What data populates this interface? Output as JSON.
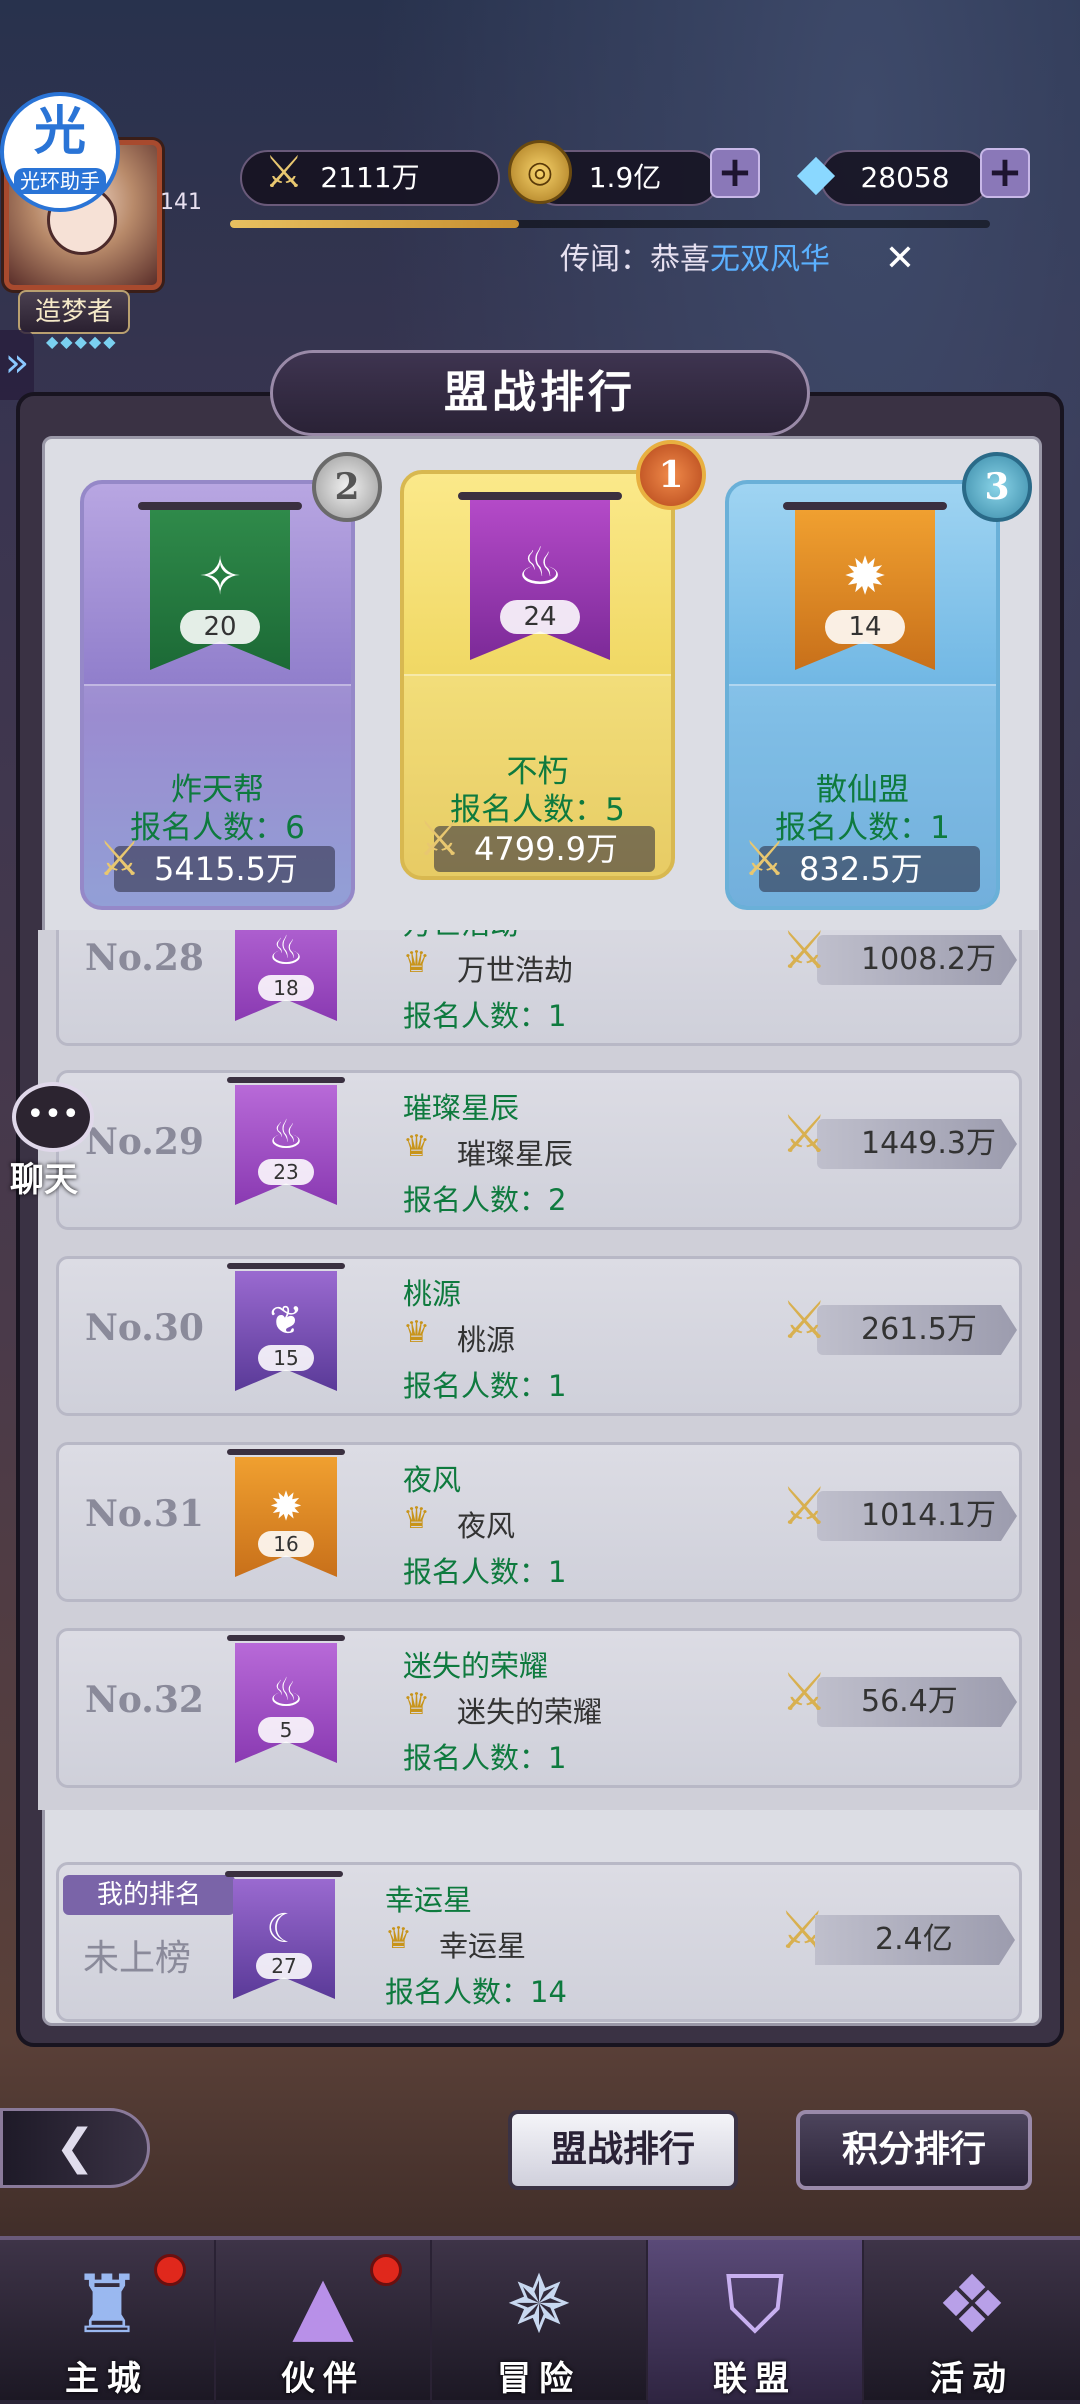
{
  "helper": {
    "icon": "光",
    "label": "光环助手"
  },
  "player": {
    "level": "141",
    "title": "造梦者",
    "stars": "◆◆◆◆◆"
  },
  "resources": {
    "power": "2111万",
    "gold": "1.9亿",
    "diamonds": "28058"
  },
  "xp_progress": 0.38,
  "news": {
    "prefix": "传闻：恭喜",
    "highlight": "无双风华"
  },
  "page_title": "盟战排行",
  "podium": [
    {
      "rank": "2",
      "badge": "20",
      "guild": "炸天帮",
      "count": "报名人数：6",
      "power": "5415.5万",
      "color": "green"
    },
    {
      "rank": "1",
      "badge": "24",
      "guild": "不朽",
      "count": "报名人数：5",
      "power": "4799.9万",
      "color": "magenta"
    },
    {
      "rank": "3",
      "badge": "14",
      "guild": "散仙盟",
      "count": "报名人数：1",
      "power": "832.5万",
      "color": "orange"
    }
  ],
  "rows": [
    {
      "no": "No.28",
      "badge": "18",
      "guild": "万世浩劫",
      "leader": "万世浩劫",
      "count": "报名人数：1",
      "power": "1008.2万"
    },
    {
      "no": "No.29",
      "badge": "23",
      "guild": "璀璨星辰",
      "leader": "璀璨星辰",
      "count": "报名人数：2",
      "power": "1449.3万"
    },
    {
      "no": "No.30",
      "badge": "15",
      "guild": "桃源",
      "leader": "桃源",
      "count": "报名人数：1",
      "power": "261.5万"
    },
    {
      "no": "No.31",
      "badge": "16",
      "guild": "夜风",
      "leader": "夜风",
      "count": "报名人数：1",
      "power": "1014.1万"
    },
    {
      "no": "No.32",
      "badge": "5",
      "guild": "迷失的荣耀",
      "leader": "迷失的荣耀",
      "count": "报名人数：1",
      "power": "56.4万"
    }
  ],
  "my_rank": {
    "tag": "我的排名",
    "status": "未上榜",
    "badge": "27",
    "guild": "幸运星",
    "leader": "幸运星",
    "count": "报名人数：14",
    "power": "2.4亿"
  },
  "chat": {
    "label": "聊天"
  },
  "tabs": {
    "active": "盟战排行",
    "other": "积分排行"
  },
  "nav": [
    {
      "label": "主城",
      "icon": "castle-icon",
      "dot": true
    },
    {
      "label": "伙伴",
      "icon": "wizard-hat-icon",
      "dot": true
    },
    {
      "label": "冒险",
      "icon": "compass-icon",
      "dot": false
    },
    {
      "label": "联盟",
      "icon": "shield-icon",
      "dot": false
    },
    {
      "label": "活动",
      "icon": "cards-icon",
      "dot": false
    }
  ]
}
